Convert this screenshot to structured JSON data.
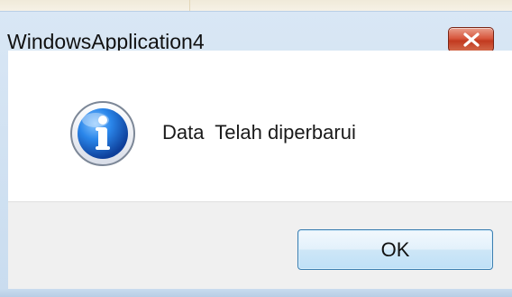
{
  "window": {
    "title": "WindowsApplication4"
  },
  "message": {
    "text": "Data  Telah diperbarui",
    "icon": "information-icon"
  },
  "buttons": {
    "ok_label": "OK",
    "close_icon": "close-icon"
  },
  "colors": {
    "titlebar": "#d9e7f5",
    "close_button": "#c94a2f",
    "ok_button_border": "#3c7fb1",
    "client_background": "#ffffff",
    "footer_background": "#f0f0f0",
    "info_icon": "#1f6dc8"
  }
}
